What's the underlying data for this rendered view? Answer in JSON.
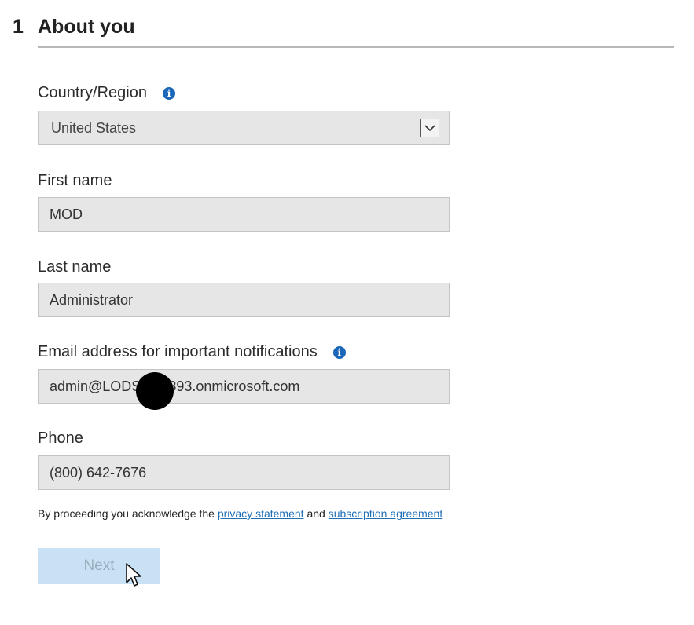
{
  "header": {
    "step_number": "1",
    "title": "About you"
  },
  "form": {
    "country": {
      "label": "Country/Region",
      "value": "United States"
    },
    "first_name": {
      "label": "First name",
      "value": "MOD"
    },
    "last_name": {
      "label": "Last name",
      "value": "Administrator"
    },
    "email": {
      "label": "Email address for important notifications",
      "value": "admin@LODS       893.onmicrosoft.com"
    },
    "phone": {
      "label": "Phone",
      "value": "(800) 642-7676"
    }
  },
  "acknowledgement": {
    "prefix": "By proceeding you acknowledge the",
    "privacy_link": "privacy statement",
    "conjunction": "and",
    "subscription_link": "subscription agreement"
  },
  "actions": {
    "next_label": "Next"
  },
  "icons": {
    "info": "info-icon",
    "dropdown": "chevron-down-icon",
    "cursor": "mouse-pointer-icon"
  },
  "colors": {
    "info_icon": "#1a66b8",
    "link": "#1f6fb8",
    "next_button_disabled_bg": "#c8e1f5",
    "field_bg": "#e6e6e6"
  }
}
